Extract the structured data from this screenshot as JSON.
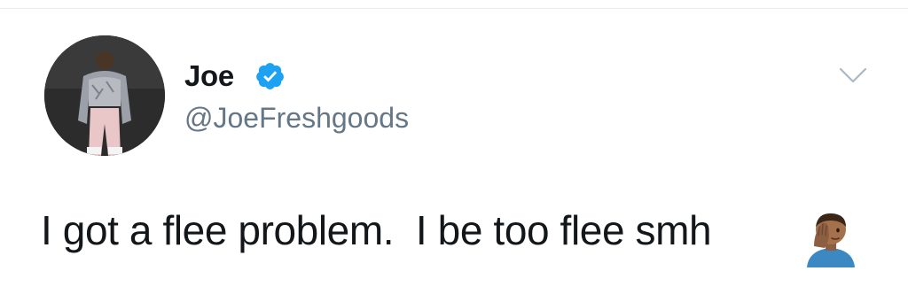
{
  "tweet": {
    "author": {
      "display_name": "Joe",
      "handle": "@JoeFreshgoods",
      "verified": true
    },
    "text": "I got a flee problem.  I be too flee smh",
    "emoji": "face-palm",
    "icons": {
      "verified": "verified-badge-icon",
      "menu": "chevron-down-icon"
    }
  },
  "colors": {
    "name": "#14171a",
    "handle": "#657786",
    "verified": "#1da1f2",
    "caret": "#aab8c2",
    "divider": "#e6ecf0"
  }
}
